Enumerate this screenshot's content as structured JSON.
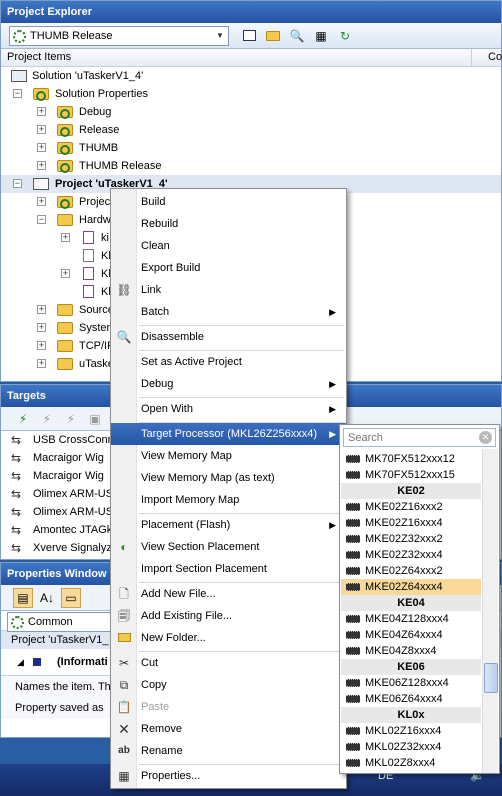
{
  "project_explorer": {
    "title": "Project Explorer",
    "config_value": "THUMB Release",
    "columns": {
      "items": "Project Items",
      "second": "Co"
    },
    "tree": [
      {
        "label": "Solution 'uTaskerV1_4'"
      },
      {
        "label": "Solution Properties"
      },
      {
        "label": "Debug"
      },
      {
        "label": "Release"
      },
      {
        "label": "THUMB"
      },
      {
        "label": "THUMB Release"
      },
      {
        "label": "Project 'uTaskerV1_4'"
      },
      {
        "label": "Projec"
      },
      {
        "label": "Hardw"
      },
      {
        "label": "ki"
      },
      {
        "label": "Kl"
      },
      {
        "label": "Kl"
      },
      {
        "label": "Kl"
      },
      {
        "label": "Source"
      },
      {
        "label": "Systen"
      },
      {
        "label": "TCP/IP"
      },
      {
        "label": "uTaske"
      }
    ]
  },
  "targets": {
    "title": "Targets",
    "items": [
      "USB CrossConn",
      "Macraigor Wig",
      "Macraigor Wig",
      "Olimex ARM-US",
      "Olimex ARM-US",
      "Amontec JTAGk",
      "Xverve Signalyz"
    ]
  },
  "properties": {
    "title": "Properties Window",
    "combo_value": "Common",
    "object_label": "Project 'uTaskerV1_",
    "section": "(Informati",
    "desc_1": "Names the item. Th",
    "desc_2": "Property saved as"
  },
  "context_menu": {
    "build": "Build",
    "rebuild": "Rebuild",
    "clean": "Clean",
    "export_build": "Export Build",
    "link": "Link",
    "batch": "Batch",
    "disassemble": "Disassemble",
    "set_active": "Set as Active Project",
    "debug": "Debug",
    "open_with": "Open With",
    "target_processor": "Target Processor (MKL26Z256xxx4)",
    "view_memory_map": "View Memory Map",
    "view_memory_map_text": "View Memory Map (as text)",
    "import_memory_map": "Import Memory Map",
    "placement_flash": "Placement (Flash)",
    "view_section_placement": "View Section Placement",
    "import_section_placement": "Import Section Placement",
    "add_new_file": "Add New File...",
    "add_existing_file": "Add Existing File...",
    "new_folder": "New Folder...",
    "cut": "Cut",
    "copy": "Copy",
    "paste": "Paste",
    "remove": "Remove",
    "rename": "Rename",
    "properties": "Properties..."
  },
  "processor_submenu": {
    "search_placeholder": "Search",
    "rows": [
      {
        "kind": "item",
        "label": "MK70FX512xxx12"
      },
      {
        "kind": "item",
        "label": "MK70FX512xxx15"
      },
      {
        "kind": "head",
        "label": "KE02"
      },
      {
        "kind": "item",
        "label": "MKE02Z16xxx2"
      },
      {
        "kind": "item",
        "label": "MKE02Z16xxx4"
      },
      {
        "kind": "item",
        "label": "MKE02Z32xxx2"
      },
      {
        "kind": "item",
        "label": "MKE02Z32xxx4"
      },
      {
        "kind": "item",
        "label": "MKE02Z64xxx2"
      },
      {
        "kind": "item",
        "label": "MKE02Z64xxx4",
        "selected": true
      },
      {
        "kind": "head",
        "label": "KE04"
      },
      {
        "kind": "item",
        "label": "MKE04Z128xxx4"
      },
      {
        "kind": "item",
        "label": "MKE04Z64xxx4"
      },
      {
        "kind": "item",
        "label": "MKE04Z8xxx4"
      },
      {
        "kind": "head",
        "label": "KE06"
      },
      {
        "kind": "item",
        "label": "MKE06Z128xxx4"
      },
      {
        "kind": "item",
        "label": "MKE06Z64xxx4"
      },
      {
        "kind": "head",
        "label": "KL0x"
      },
      {
        "kind": "item",
        "label": "MKL02Z16xxx4"
      },
      {
        "kind": "item",
        "label": "MKL02Z32xxx4"
      },
      {
        "kind": "item",
        "label": "MKL02Z8xxx4"
      }
    ]
  },
  "taskbar": {
    "language": "DE"
  },
  "colors": {
    "title_bar": "#2553a3",
    "highlight": "#2757a8",
    "selected_item": "#f8d99a"
  }
}
